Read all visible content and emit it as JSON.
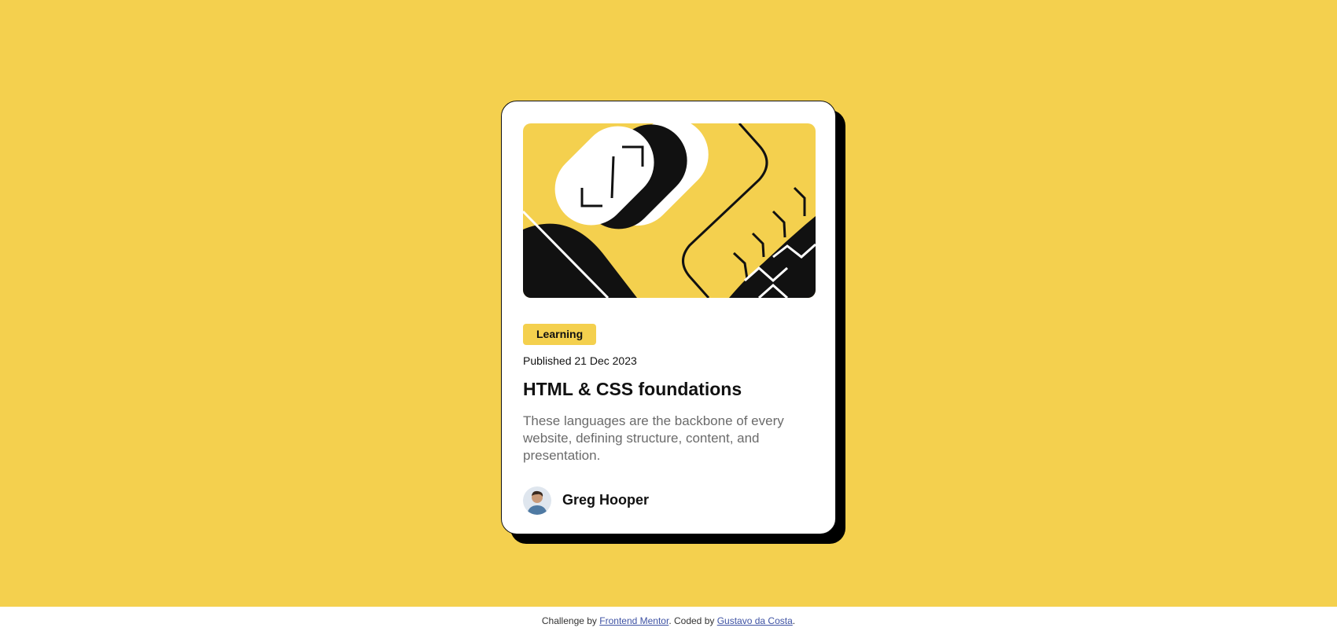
{
  "card": {
    "tag": "Learning",
    "published": "Published 21 Dec 2023",
    "title": "HTML & CSS foundations",
    "description": "These languages are the backbone of every website, defining structure, content, and presentation.",
    "author": "Greg Hooper"
  },
  "footer": {
    "prefix": "Challenge by ",
    "link1": "Frontend Mentor",
    "middle": ". Coded by ",
    "link2": "Gustavo da Costa",
    "suffix": "."
  },
  "colors": {
    "accent": "#f4d04e",
    "text": "#111111",
    "muted": "#6b6b6b",
    "link": "#3e52a3"
  },
  "icons": [
    "hero-illustration",
    "author-avatar"
  ]
}
